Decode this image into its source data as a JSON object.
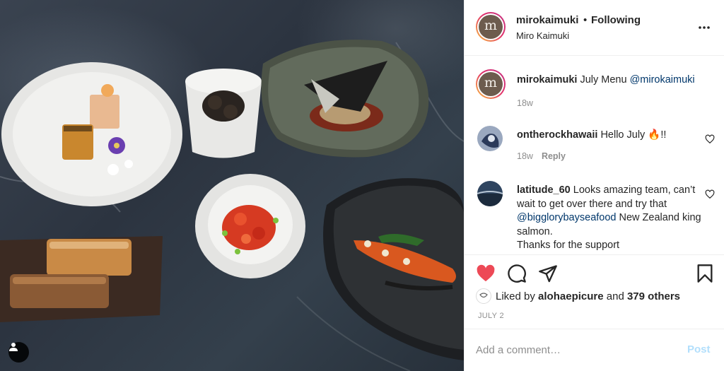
{
  "post": {
    "username": "mirokaimuki",
    "follow_separator": "•",
    "follow_status": "Following",
    "location": "Miro Kaimuki",
    "avatar_letter": "m"
  },
  "caption": {
    "username": "mirokaimuki",
    "text": "July Menu",
    "mention": "@mirokaimuki",
    "age": "18w"
  },
  "comments": [
    {
      "username": "ontherockhawaii",
      "text": "Hello July 🔥!!",
      "age": "18w",
      "reply_label": "Reply"
    },
    {
      "username": "latitude_60",
      "text_before": "Looks amazing team, can’t wait to get over there and try that",
      "mention": "@bigglorybayseafood",
      "text_after": "New Zealand king salmon.",
      "line_last": "Thanks for the support"
    }
  ],
  "likes": {
    "prefix": "Liked by",
    "liker": "alohaepicure",
    "middle": "and",
    "others": "379 others"
  },
  "date": "JULY 2",
  "comment_box": {
    "placeholder": "Add a comment…",
    "post_label": "Post"
  },
  "icons": {
    "like": "heart-filled-icon",
    "comment": "speech-bubble-icon",
    "share": "paper-plane-icon",
    "save": "bookmark-icon",
    "more": "more-options-icon",
    "user_tag": "person-icon"
  },
  "colors": {
    "like_red": "#ed4956",
    "mention_blue": "#00376b",
    "post_disabled": "#b2dffc",
    "muted": "#8e8e8e"
  }
}
